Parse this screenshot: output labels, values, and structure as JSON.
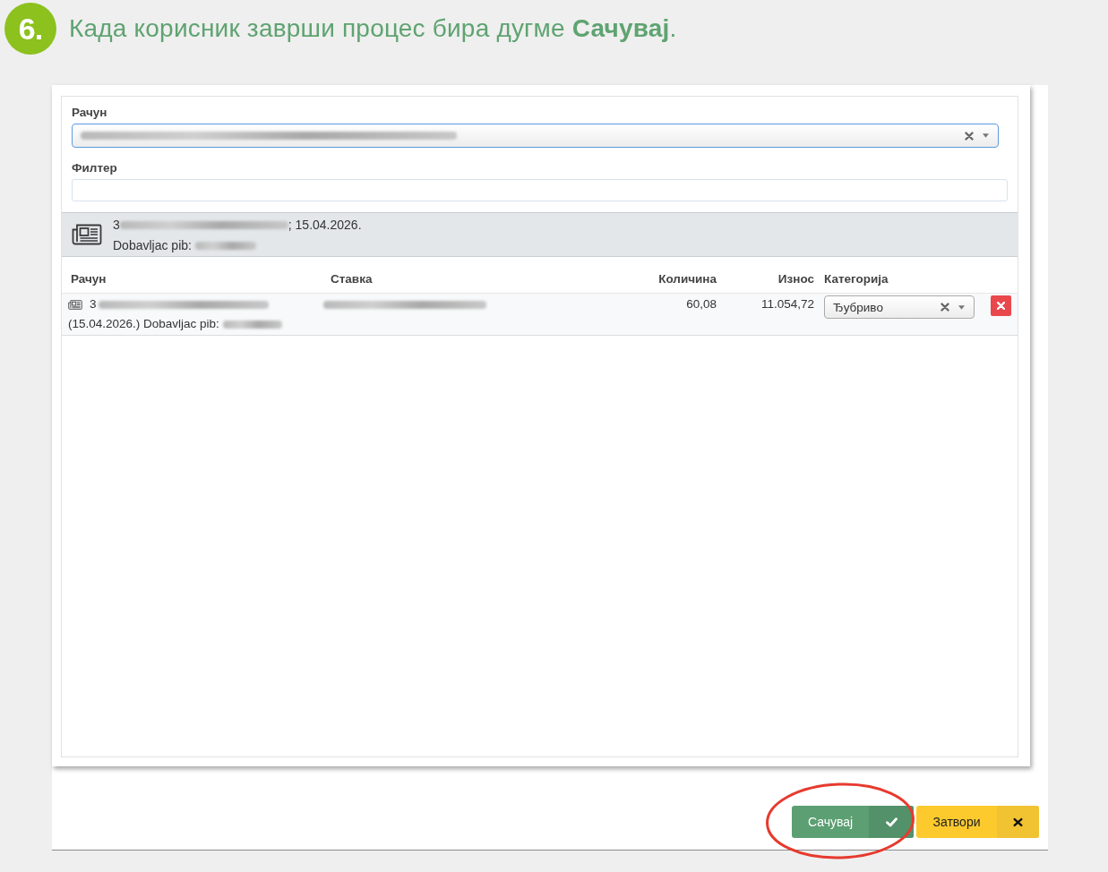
{
  "instruction": {
    "step": "6.",
    "text": "Када корисник заврши процес бира дугме **Сачувај**."
  },
  "form": {
    "fields": [
      {
        "kind": "select",
        "label": "Рачун",
        "focused": true
      },
      {
        "kind": "text",
        "label": "Филтер",
        "focused": false
      }
    ]
  },
  "invoice_card": {
    "invoice_prefix": "3",
    "date": "; 15.04.2026.",
    "supplier_label": "Dobavljac pib:"
  },
  "table": {
    "columns": [
      {
        "label": "Рачун",
        "numeric": false
      },
      {
        "label": "Ставка",
        "numeric": false
      },
      {
        "label": "Количина",
        "numeric": true
      },
      {
        "label": "Износ",
        "numeric": true
      },
      {
        "label": "Категорија",
        "numeric": false
      }
    ],
    "rows": [
      {
        "invoice_prefix": "3",
        "invoice_details": "(15.04.2026.) Dobavljac pib:",
        "quantity": "60,08",
        "amount": "11.054,72",
        "category": "Ђубриво"
      }
    ]
  },
  "buttons": [
    {
      "kind": "save",
      "label": "Сачувај",
      "highlighted": true
    },
    {
      "kind": "close",
      "label": "Затвори",
      "highlighted": false
    }
  ]
}
